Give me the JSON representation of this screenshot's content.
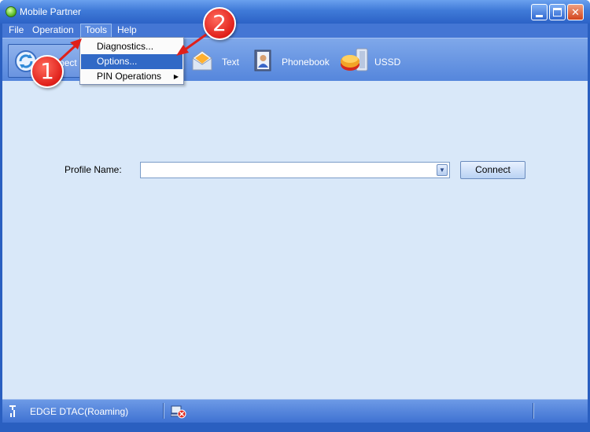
{
  "window": {
    "title": "Mobile Partner"
  },
  "menubar": {
    "items": [
      "File",
      "Operation",
      "Tools",
      "Help"
    ]
  },
  "toolbar": {
    "items": [
      {
        "label": "Connect",
        "icon": "connect-icon"
      },
      {
        "label": "Text",
        "icon": "envelope-icon"
      },
      {
        "label": "Phonebook",
        "icon": "phonebook-icon"
      },
      {
        "label": "USSD",
        "icon": "ussd-icon"
      }
    ]
  },
  "tools_menu": {
    "items": [
      "Diagnostics...",
      "Options...",
      "PIN Operations"
    ],
    "highlighted": "Options..."
  },
  "main": {
    "profile_label": "Profile Name:",
    "profile_value": "",
    "connect_button": "Connect"
  },
  "statusbar": {
    "text": "EDGE  DTAC(Roaming)"
  },
  "annotations": {
    "badge1": "1",
    "badge2": "2"
  },
  "colors": {
    "accent": "#3169c6",
    "content_bg": "#d9e8f9",
    "annotation": "#e0201a"
  }
}
